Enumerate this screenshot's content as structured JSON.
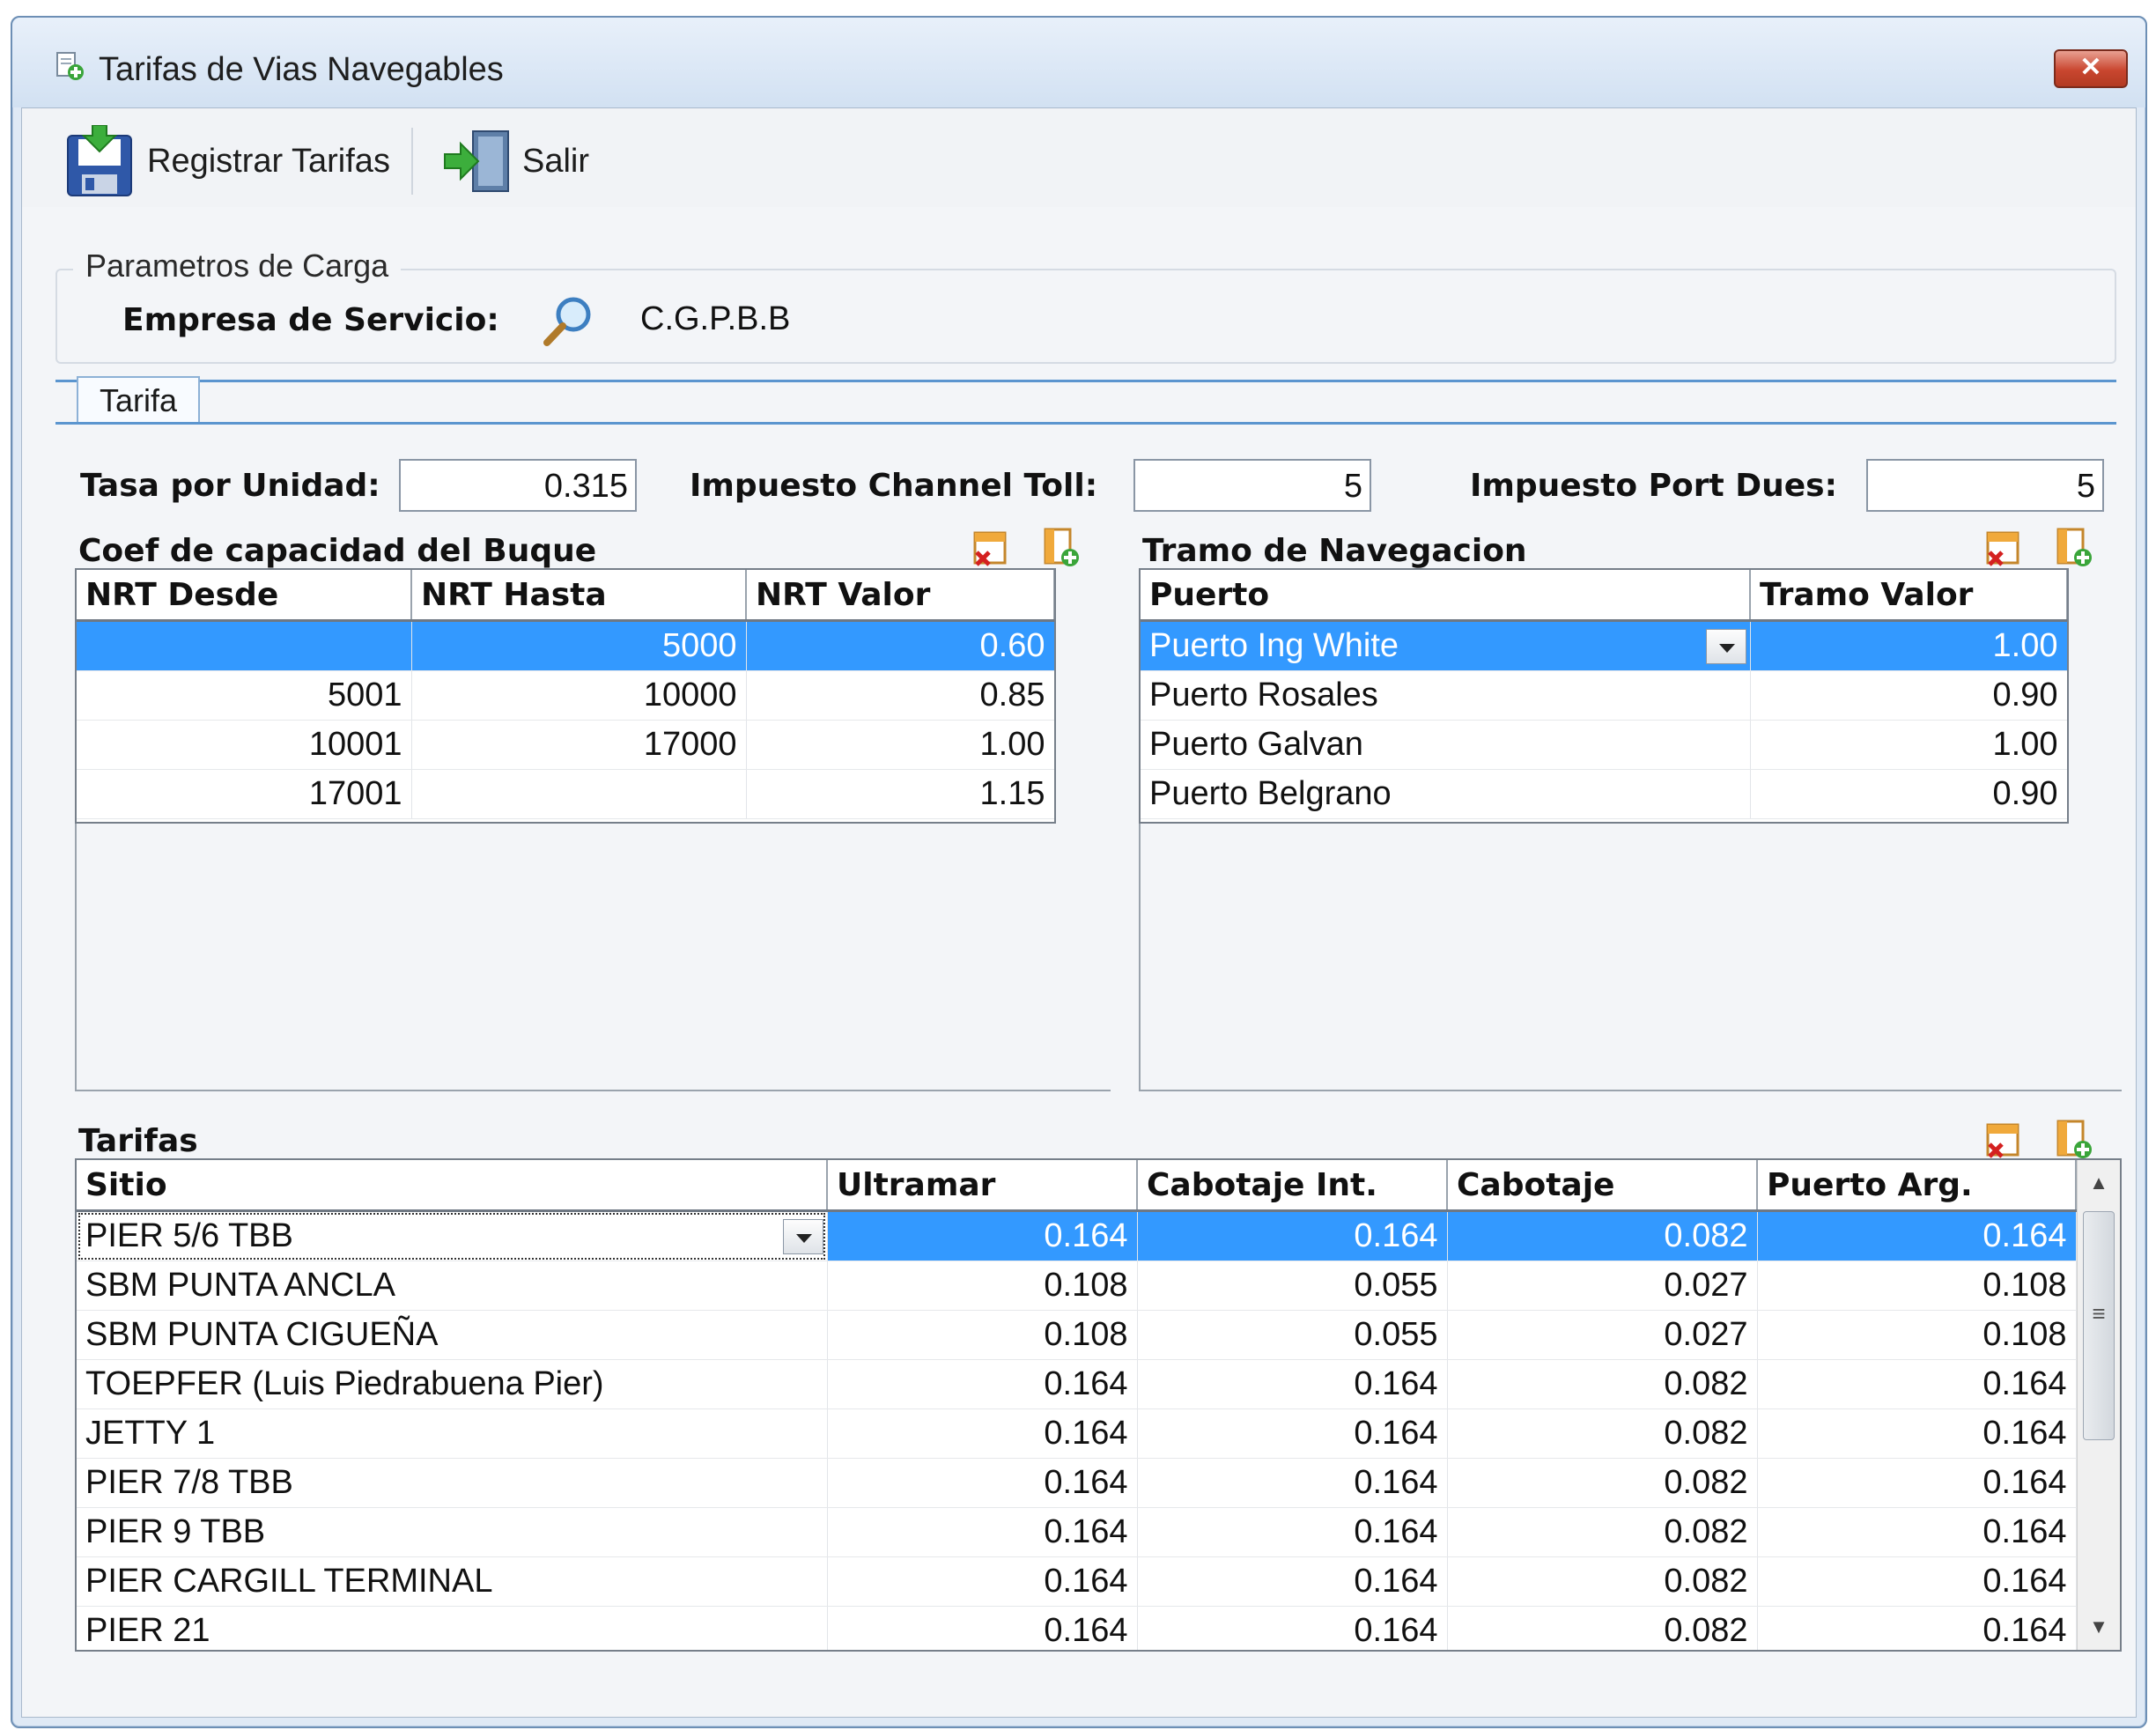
{
  "window": {
    "title": "Tarifas de Vias Navegables",
    "close_label": "✕"
  },
  "toolbar": {
    "register_label": "Registrar Tarifas",
    "exit_label": "Salir"
  },
  "params": {
    "legend": "Parametros de Carga",
    "empresa_label": "Empresa de Servicio:",
    "empresa_value": "C.G.P.B.B"
  },
  "tabs": [
    {
      "label": "Tarifa"
    }
  ],
  "fields": {
    "tasa_label": "Tasa por Unidad:",
    "tasa_value": "0.315",
    "channel_label": "Impuesto Channel Toll:",
    "channel_value": "5",
    "port_label": "Impuesto Port Dues:",
    "port_value": "5"
  },
  "coef": {
    "title": "Coef de capacidad del Buque",
    "columns": [
      "NRT Desde",
      "NRT Hasta",
      "NRT Valor"
    ],
    "rows": [
      [
        "",
        "5000",
        "0.60"
      ],
      [
        "5001",
        "10000",
        "0.85"
      ],
      [
        "10001",
        "17000",
        "1.00"
      ],
      [
        "17001",
        "",
        "1.15"
      ]
    ]
  },
  "tramo": {
    "title": "Tramo de Navegacion",
    "columns": [
      "Puerto",
      "Tramo Valor"
    ],
    "rows": [
      [
        "Puerto Ing White",
        "1.00"
      ],
      [
        "Puerto Rosales",
        "0.90"
      ],
      [
        "Puerto Galvan",
        "1.00"
      ],
      [
        "Puerto Belgrano",
        "0.90"
      ]
    ]
  },
  "tarifas": {
    "title": "Tarifas",
    "columns": [
      "Sitio",
      "Ultramar",
      "Cabotaje Int.",
      "Cabotaje",
      "Puerto Arg."
    ],
    "rows": [
      [
        "PIER 5/6 TBB",
        "0.164",
        "0.164",
        "0.082",
        "0.164"
      ],
      [
        "SBM PUNTA ANCLA",
        "0.108",
        "0.055",
        "0.027",
        "0.108"
      ],
      [
        "SBM PUNTA CIGUEÑA",
        "0.108",
        "0.055",
        "0.027",
        "0.108"
      ],
      [
        "TOEPFER (Luis Piedrabuena Pier)",
        "0.164",
        "0.164",
        "0.082",
        "0.164"
      ],
      [
        "JETTY 1",
        "0.164",
        "0.164",
        "0.082",
        "0.164"
      ],
      [
        "PIER 7/8 TBB",
        "0.164",
        "0.164",
        "0.082",
        "0.164"
      ],
      [
        "PIER 9 TBB",
        "0.164",
        "0.164",
        "0.082",
        "0.164"
      ],
      [
        "PIER CARGILL TERMINAL",
        "0.164",
        "0.164",
        "0.082",
        "0.164"
      ],
      [
        "PIER 21",
        "0.164",
        "0.164",
        "0.082",
        "0.164"
      ]
    ]
  }
}
